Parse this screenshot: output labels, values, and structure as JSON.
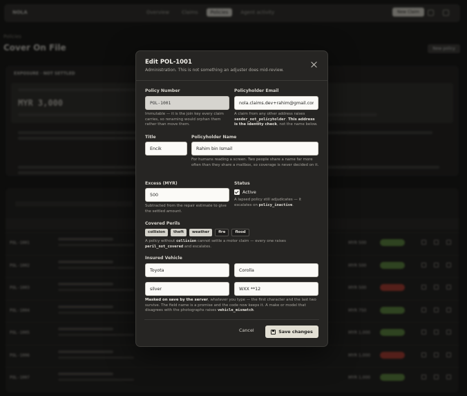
{
  "modal": {
    "title": "Edit POL-1001",
    "subtitle": "Administration. This is not something an adjuster does mid-review.",
    "policy_number": {
      "label": "Policy Number",
      "value": "POL-1001",
      "hint": "Immutable — it is the join key every claim carries, so renaming would orphan them rather than move them."
    },
    "email": {
      "label": "Policyholder Email",
      "value": "nola.claims.dev+rahim@gmail.com",
      "hint_a": "A claim from any other address raises ",
      "hint_code": "sender_not_policyholder",
      "hint_b": ". ",
      "hint_bold": "This address is the identity check",
      "hint_c": ", not the name below."
    },
    "title_field": {
      "label": "Title",
      "value": "Encik"
    },
    "name": {
      "label": "Policyholder Name",
      "value": "Rahim bin Ismail",
      "hint": "For humans reading a screen. Two people share a name far more often than they share a mailbox, so coverage is never decided on it."
    },
    "excess": {
      "label": "Excess (MYR)",
      "value": "500",
      "hint": "Subtracted from the repair estimate to give the settled amount."
    },
    "status": {
      "label": "Status",
      "checkbox_label": "Active",
      "hint_a": "A lapsed policy still adjudicates — it escalates on ",
      "hint_code": "policy_inactive",
      "hint_b": "."
    },
    "perils": {
      "label": "Covered Perils",
      "chips": [
        "collision",
        "theft",
        "weather",
        "fire",
        "flood"
      ],
      "hint_a": "A policy without ",
      "hint_code1": "collision",
      "hint_b": " cannot settle a motor claim — every one raises ",
      "hint_code2": "peril_not_covered",
      "hint_c": " and escalates."
    },
    "vehicle": {
      "label": "Insured Vehicle",
      "make": "Toyota",
      "model": "Corolla",
      "color": "silver",
      "plate": "WXX **12",
      "hint_bold": "Masked on save by the server",
      "hint_a": ", whatever you type — the first character and the last two survive. The field name is a promise and the code now keeps it. A make or model that disagrees with the photographs raises ",
      "hint_code": "vehicle_mismatch",
      "hint_b": "."
    },
    "cancel_label": "Cancel",
    "save_label": "Save changes"
  },
  "background": {
    "page_title": "Cover On File",
    "breadcrumb": "Policies",
    "rows": [
      {
        "id": "POL-1001",
        "amount": "MYR 500",
        "status": "active"
      },
      {
        "id": "POL-1002",
        "amount": "MYR 500",
        "status": "active"
      },
      {
        "id": "POL-1003",
        "amount": "MYR 500",
        "status": "lapsed"
      },
      {
        "id": "POL-1004",
        "amount": "MYR 750",
        "status": "active"
      },
      {
        "id": "POL-1005",
        "amount": "MYR 1,000",
        "status": "active"
      },
      {
        "id": "POL-1006",
        "amount": "MYR 1,000",
        "status": "lapsed"
      },
      {
        "id": "POL-1007",
        "amount": "MYR 1,000",
        "status": "active"
      }
    ]
  },
  "colors": {
    "chip_active": "#d6d4cc",
    "status_active": "#5f8f3e",
    "status_lapsed": "#b63a2e",
    "primary_button": "#e2dfd3"
  }
}
